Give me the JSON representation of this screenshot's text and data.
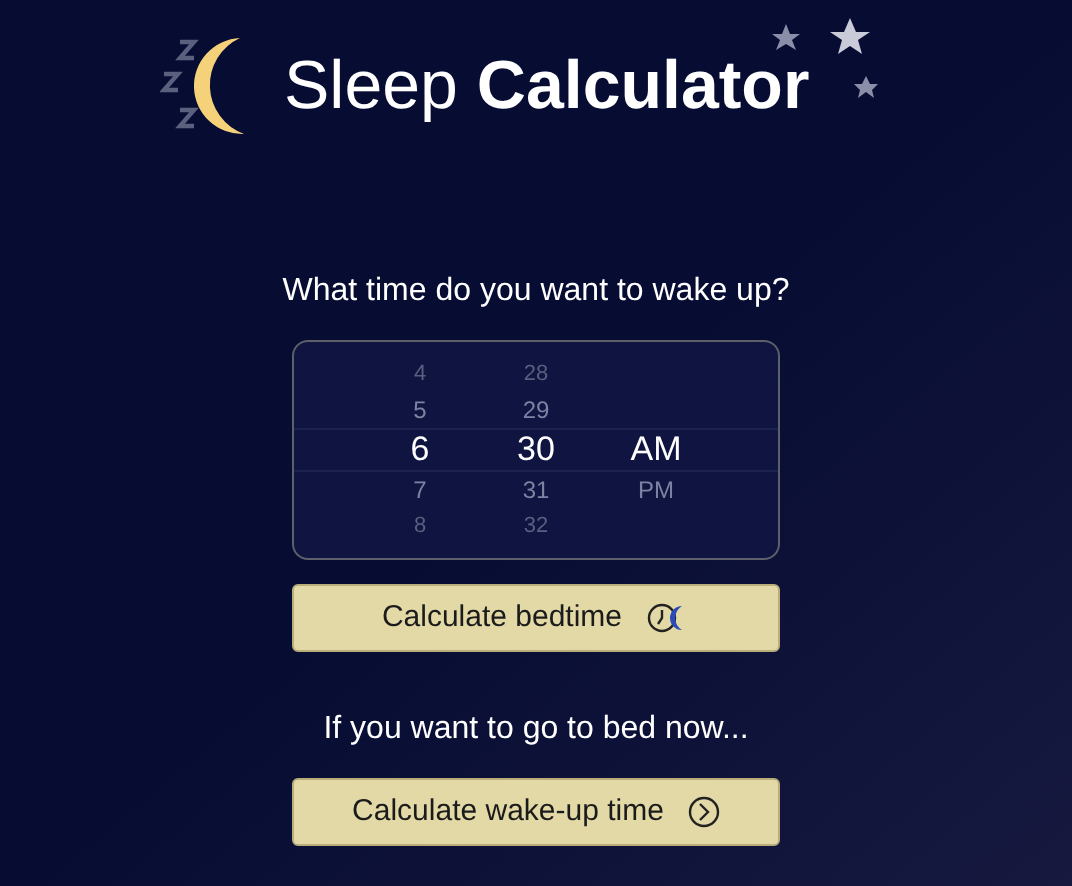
{
  "title": {
    "light": "Sleep",
    "bold": "Calculator"
  },
  "question": "What time do you want to wake up?",
  "picker": {
    "columns": [
      {
        "kind": "hour",
        "items": [
          {
            "label": "4",
            "selected": false
          },
          {
            "label": "5",
            "selected": false
          },
          {
            "label": "6",
            "selected": true
          },
          {
            "label": "7",
            "selected": false
          },
          {
            "label": "8",
            "selected": false
          }
        ]
      },
      {
        "kind": "minute",
        "items": [
          {
            "label": "28",
            "selected": false
          },
          {
            "label": "29",
            "selected": false
          },
          {
            "label": "30",
            "selected": true
          },
          {
            "label": "31",
            "selected": false
          },
          {
            "label": "32",
            "selected": false
          }
        ]
      },
      {
        "kind": "period",
        "items": [
          {
            "label": "AM",
            "selected": true
          },
          {
            "label": "PM",
            "selected": false
          }
        ]
      }
    ]
  },
  "bedtime_button": "Calculate bedtime",
  "now_prompt": "If you want to go to bed now...",
  "wakeup_button": "Calculate wake-up time"
}
